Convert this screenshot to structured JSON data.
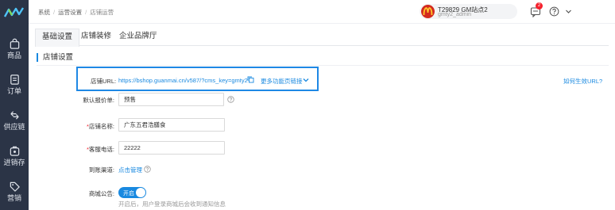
{
  "sidebar": {
    "items": [
      {
        "label": "商品",
        "icon": "bag-icon"
      },
      {
        "label": "订单",
        "icon": "order-icon"
      },
      {
        "label": "供应链",
        "icon": "supply-chain-icon"
      },
      {
        "label": "进销存",
        "icon": "inventory-icon"
      },
      {
        "label": "营销",
        "icon": "tag-icon"
      }
    ]
  },
  "header": {
    "breadcrumb": [
      "系统",
      "运营设置",
      "店铺运营"
    ],
    "user": {
      "name": "T29829 GM站点2",
      "account": "gmty2_admin"
    },
    "message_count": "2"
  },
  "tabs": [
    {
      "label": "基础设置",
      "active": true
    },
    {
      "label": "店铺装修",
      "active": false
    },
    {
      "label": "企业品牌厅",
      "active": false
    }
  ],
  "section": {
    "title": "店铺设置"
  },
  "url_row": {
    "label": "店铺URL:",
    "url": "https://bshop.guanmai.cn/v587/?cms_key=gmty2",
    "more_label": "更多功能页链接",
    "effect_link": "如何生效URL?"
  },
  "form": {
    "price_label": "默认报价单:",
    "price_value": "预售",
    "name_label": "店铺名称:",
    "name_value": "广东五君浩膳食",
    "phone_label": "客服电话:",
    "phone_value": "22222",
    "channel_label": "到账渠道:",
    "channel_link": "点击管理",
    "notice_label": "商城公告:",
    "toggle_label": "开启",
    "notice_hint": "开启后，用户登录商城后会收到通知信息"
  },
  "colors": {
    "sidebar": "#2b3446",
    "accent": "#1989e0",
    "required": "#f5222d"
  }
}
